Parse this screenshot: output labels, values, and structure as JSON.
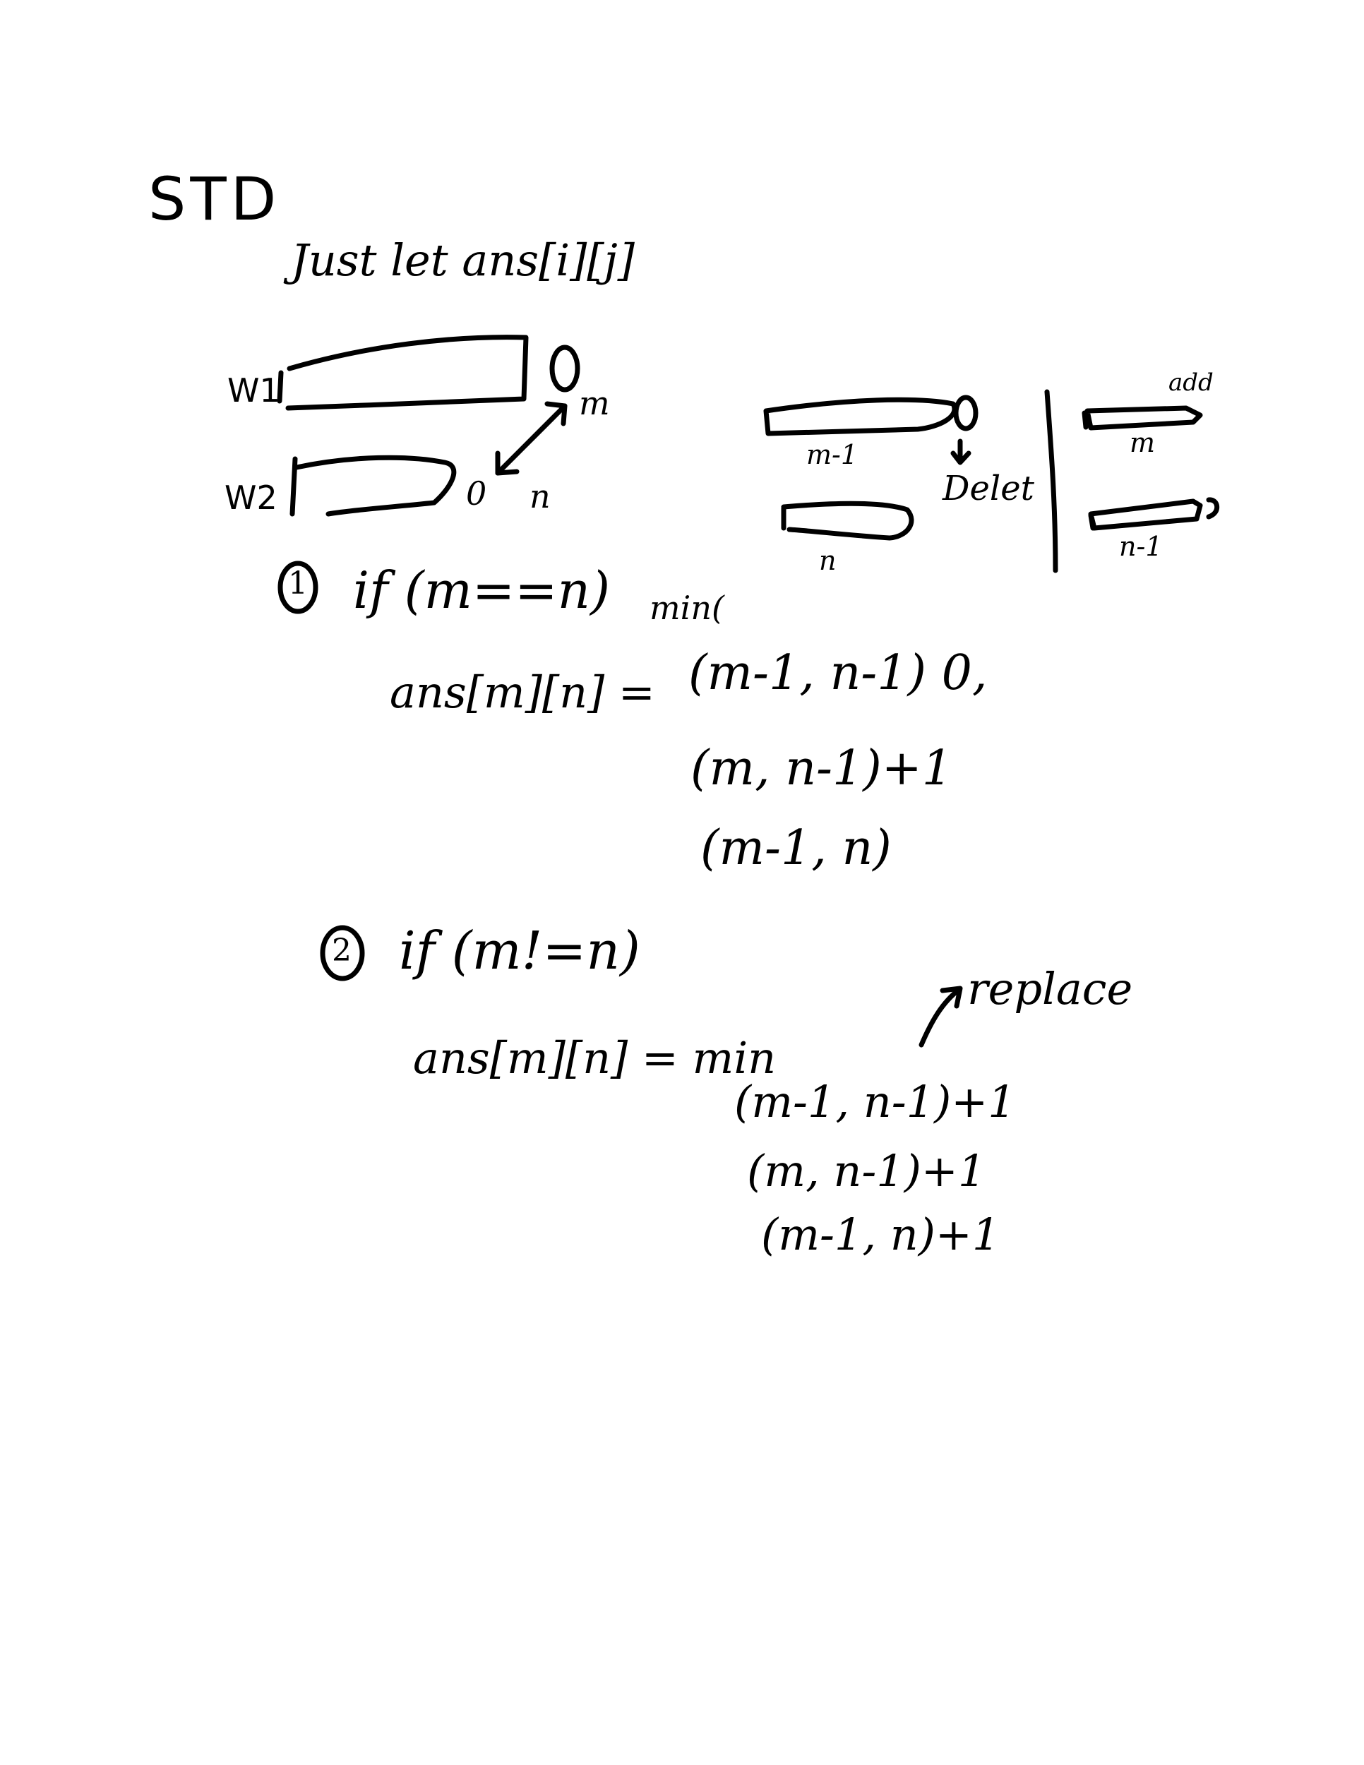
{
  "note": {
    "heading": "STD",
    "intro": "Just let ans[i][j]",
    "diagram_left": {
      "w1_label": "W1",
      "w2_label": "W2",
      "m_label": "m",
      "n_label": "n",
      "zero_a": "0",
      "zero_b": "0"
    },
    "diagram_right": {
      "m1_label": "m-1",
      "n_label": "n",
      "delete_label": "Delet",
      "m_label": "m",
      "n1_label": "n-1",
      "add_label": "add"
    },
    "case1": {
      "marker": "1",
      "condition": "if (m==n)",
      "min_label": "min(",
      "lhs": "ans[m][n] =",
      "line1": "(m-1, n-1) 0,",
      "line2": "(m, n-1)+1",
      "line3": "(m-1, n)"
    },
    "case2": {
      "marker": "2",
      "condition": "if (m!=n)",
      "lhs": "ans[m][n] = min",
      "replace_label": "replace",
      "line1": "(m-1, n-1)+1",
      "line2": "(m, n-1)+1",
      "line3": "(m-1, n)+1"
    }
  }
}
